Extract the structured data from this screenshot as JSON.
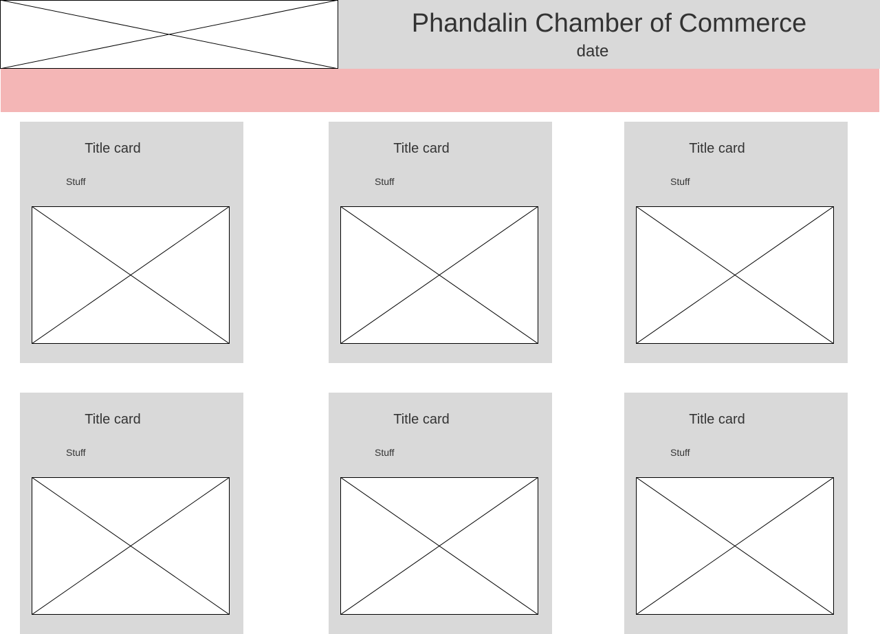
{
  "header": {
    "title": "Phandalin Chamber of Commerce",
    "date": "date"
  },
  "cards": [
    {
      "title": "Title card",
      "body": "Stuff"
    },
    {
      "title": "Title card",
      "body": "Stuff"
    },
    {
      "title": "Title card",
      "body": "Stuff"
    },
    {
      "title": "Title card",
      "body": "Stuff"
    },
    {
      "title": "Title card",
      "body": "Stuff"
    },
    {
      "title": "Title card",
      "body": "Stuff"
    }
  ],
  "colors": {
    "header_bg": "#d9d9d9",
    "nav_band": "#f4b6b6",
    "card_bg": "#d9d9d9",
    "text": "#333333"
  }
}
